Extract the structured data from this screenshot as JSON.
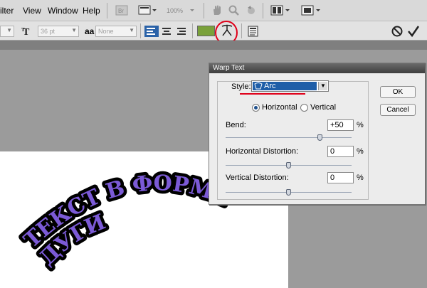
{
  "menubar": {
    "items": [
      "ilter",
      "View",
      "Window",
      "Help"
    ],
    "zoom": "100%"
  },
  "options_bar": {
    "font_size": "36 pt",
    "aa_label": "aa",
    "antialias": "None",
    "text_color": "#7aa13a"
  },
  "canvas": {
    "text_top": "ТЕКСТ В ФОРМЕ",
    "text_bottom": "ДУГИ",
    "text_color": "#7b5ad6"
  },
  "warp_dialog": {
    "title": "Warp Text",
    "style_label": "Style:",
    "style_value": "Arc",
    "horizontal_label": "Horizontal",
    "vertical_label": "Vertical",
    "orientation": "Horizontal",
    "bend_label": "Bend:",
    "bend_value": "+50",
    "bend_level": 50,
    "h_distortion_label": "Horizontal Distortion:",
    "h_distortion_value": "0",
    "h_distortion_level": 0,
    "v_distortion_label": "Vertical Distortion:",
    "v_distortion_value": "0",
    "v_distortion_level": 0,
    "percent": "%",
    "ok_label": "OK",
    "cancel_label": "Cancel"
  },
  "annotations": {
    "circle_color": "#e0001a",
    "underline_color": "#e0001a"
  }
}
